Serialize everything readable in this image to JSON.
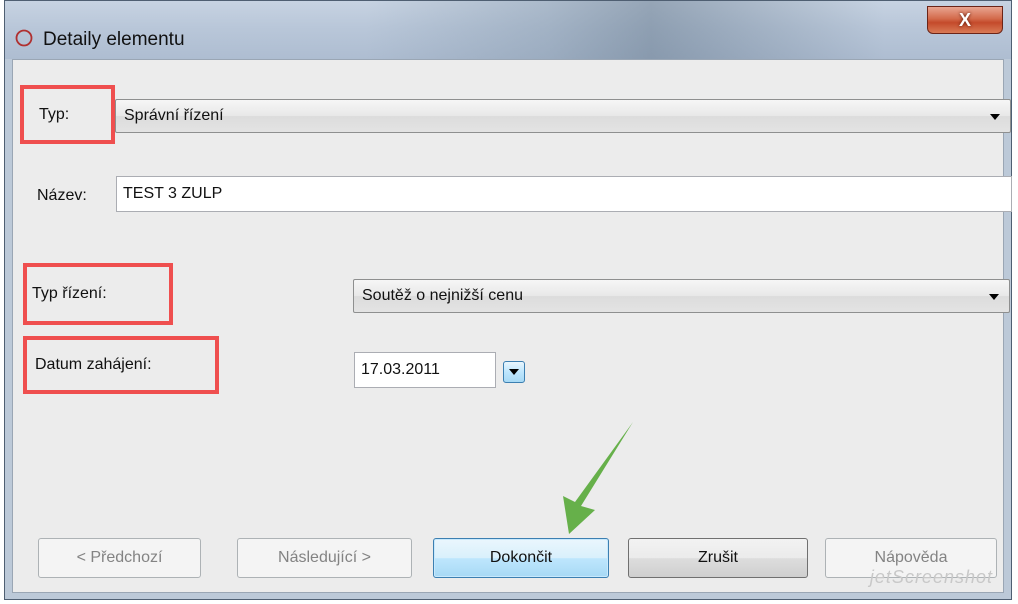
{
  "window": {
    "title": "Detaily elementu",
    "close_label": "X"
  },
  "form": {
    "typ": {
      "label": "Typ:",
      "value": "Správní řízení"
    },
    "nazev": {
      "label": "Název:",
      "value": "TEST 3 ZULP"
    },
    "typ_rizeni": {
      "label": "Typ řízení:",
      "value": "Soutěž o nejnižší cenu"
    },
    "datum": {
      "label": "Datum zahájení:",
      "value": "17.03.2011"
    }
  },
  "buttons": {
    "prev": "< Předchozí",
    "next": "Následující >",
    "finish": "Dokončit",
    "cancel": "Zrušit",
    "help": "Nápověda"
  },
  "colors": {
    "highlight": "#ef4f4f",
    "arrow": "#66b04a"
  },
  "watermark": "jetScreenshot"
}
